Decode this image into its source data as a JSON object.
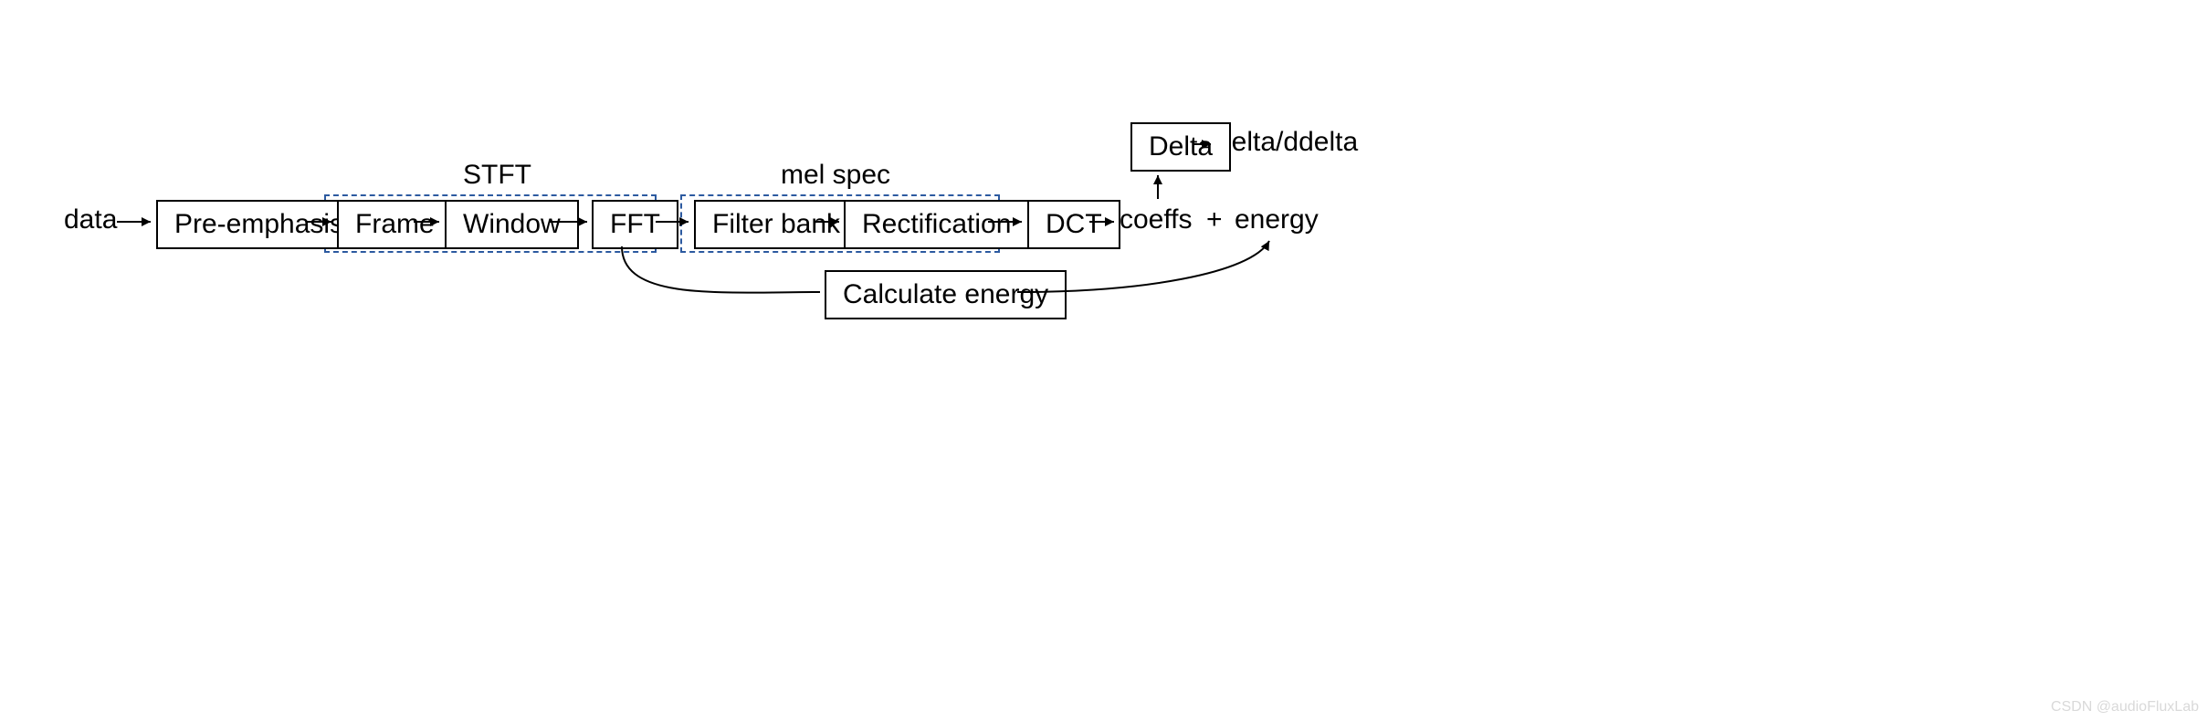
{
  "nodes": {
    "data": "data",
    "preemphasis": "Pre-emphasis",
    "frame": "Frame",
    "window": "Window",
    "fft": "FFT",
    "filterbank": "Filter bank",
    "rectification": "Rectification",
    "dct": "DCT",
    "coeffs": "coeffs",
    "plus": "+",
    "energy": "energy",
    "delta": "Delta",
    "delta_out": "delta/ddelta",
    "calc_energy": "Calculate energy"
  },
  "groups": {
    "stft": "STFT",
    "melspec": "mel spec"
  },
  "watermark": "CSDN @audioFluxLab"
}
